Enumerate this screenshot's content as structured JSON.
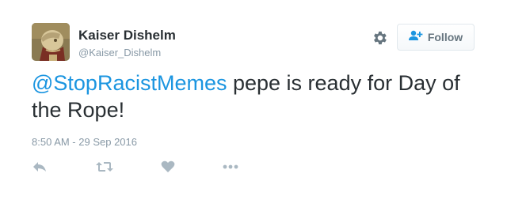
{
  "tweet": {
    "author": {
      "name": "Kaiser Dishelm",
      "handle": "@Kaiser_Dishelm",
      "avatar_icon": "avatar-image"
    },
    "mention": "@StopRacistMemes",
    "body": " pepe is ready for Day of the Rope!",
    "timestamp": "8:50 AM - 29 Sep 2016"
  },
  "header_actions": {
    "settings_icon": "gear-icon",
    "follow_label": "Follow",
    "follow_icon": "add-user-icon"
  },
  "actions": [
    {
      "name": "reply",
      "icon": "reply-icon"
    },
    {
      "name": "retweet",
      "icon": "retweet-icon"
    },
    {
      "name": "like",
      "icon": "heart-icon"
    },
    {
      "name": "more",
      "icon": "more-icon"
    }
  ],
  "colors": {
    "text": "#292f33",
    "muted": "#8899a6",
    "link": "#1b95e0",
    "icon": "#aab8c2",
    "button_border": "#e1e8ed"
  }
}
